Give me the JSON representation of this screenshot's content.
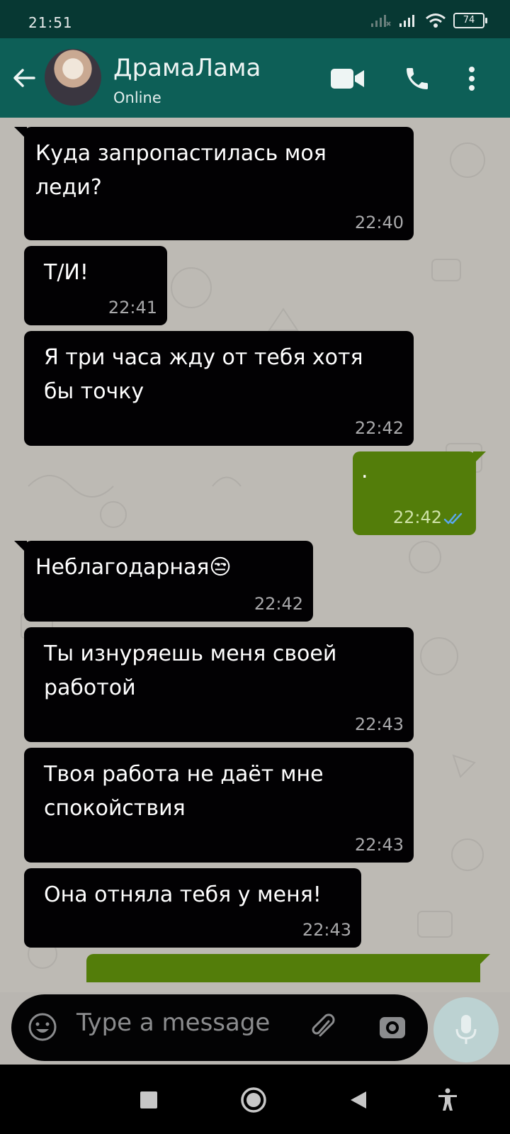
{
  "status_bar": {
    "time": "21:51",
    "battery": "74"
  },
  "header": {
    "contact_name": "ДрамаЛама",
    "contact_status": "Online"
  },
  "messages": [
    {
      "direction": "in",
      "text": "Куда запропастилась моя леди?",
      "time": "22:40"
    },
    {
      "direction": "in",
      "text": "Т/И!",
      "time": "22:41"
    },
    {
      "direction": "in",
      "text": "Я три часа жду от тебя хотя бы точку",
      "time": "22:42"
    },
    {
      "direction": "out",
      "text": ".",
      "time": "22:42",
      "read": true
    },
    {
      "direction": "in",
      "text": "Неблагодарная😒",
      "time": "22:42"
    },
    {
      "direction": "in",
      "text": "Ты изнуряешь меня своей работой",
      "time": "22:43"
    },
    {
      "direction": "in",
      "text": "Твоя работа не даёт мне спокойствия",
      "time": "22:43"
    },
    {
      "direction": "in",
      "text": "Она отняла тебя у меня!",
      "time": "22:43"
    }
  ],
  "composer": {
    "placeholder": "Type a message"
  },
  "colors": {
    "incoming": "#020103",
    "outgoing": "#537d0a",
    "header": "#0d5f57",
    "status_bar": "#073833"
  },
  "icons": [
    "back-arrow-icon",
    "video-call-icon",
    "phone-icon",
    "more-icon",
    "emoji-icon",
    "attach-icon",
    "camera-icon",
    "mic-icon",
    "double-check-icon",
    "square-icon",
    "circle-icon",
    "triangle-icon",
    "accessibility-icon"
  ]
}
